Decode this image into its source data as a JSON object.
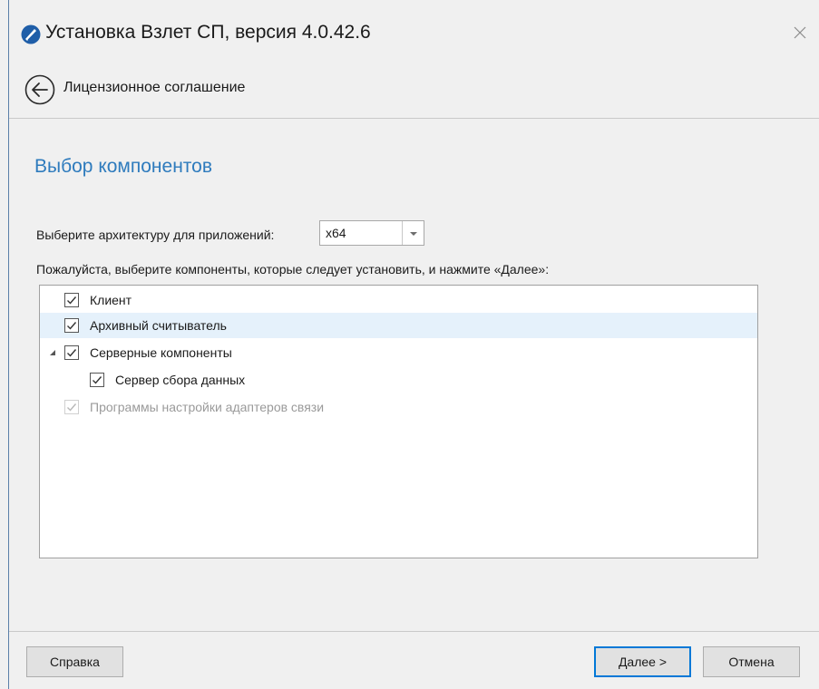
{
  "window": {
    "title": "Установка Взлет СП, версия 4.0.42.6",
    "accent_color": "#2e7bbd",
    "icon": "app-logo-icon",
    "close_icon": "close-icon"
  },
  "nav": {
    "back_icon": "back-arrow-icon",
    "back_label": "Лицензионное соглашение"
  },
  "page": {
    "title": "Выбор компонентов",
    "arch_label": "Выберите архитектуру для приложений:",
    "arch_value": "x64",
    "components_label": "Пожалуйста, выберите компоненты, которые следует установить, и нажмите «Далее»:"
  },
  "components": [
    {
      "label": "Клиент",
      "checked": true,
      "level": 0,
      "enabled": true,
      "selected": false
    },
    {
      "label": "Архивный считыватель",
      "checked": true,
      "level": 0,
      "enabled": true,
      "selected": true
    },
    {
      "label": "Серверные компоненты",
      "checked": true,
      "level": 0,
      "enabled": true,
      "selected": false,
      "expandable": true,
      "expanded": true
    },
    {
      "label": "Сервер сбора данных",
      "checked": true,
      "level": 1,
      "enabled": true,
      "selected": false
    },
    {
      "label": "Программы настройки адаптеров связи",
      "checked": true,
      "level": 0,
      "enabled": false,
      "selected": false
    }
  ],
  "footer": {
    "help_label": "Справка",
    "next_label": "Далее >",
    "cancel_label": "Отмена"
  }
}
